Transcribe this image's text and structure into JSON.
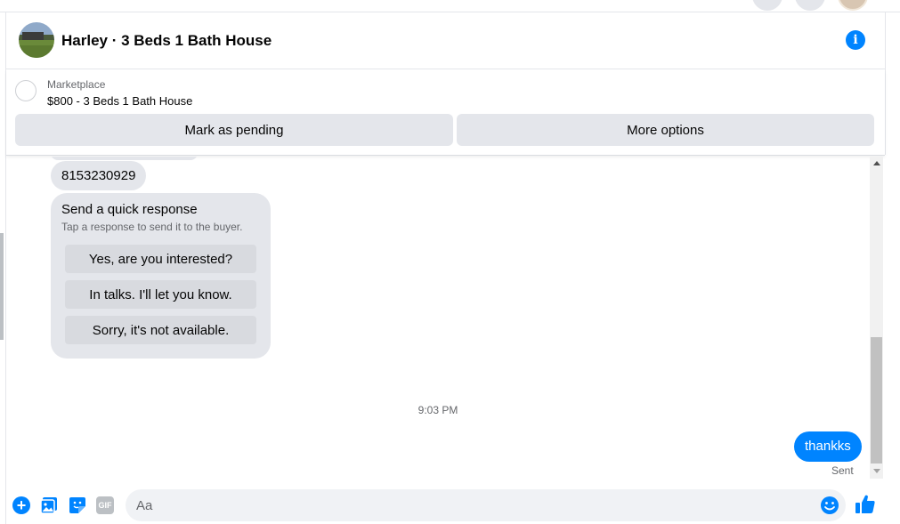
{
  "conversation": {
    "title": "Harley · 3 Beds 1 Bath House",
    "info_icon": "info-icon"
  },
  "marketplace": {
    "label": "Marketplace",
    "item": "$800 - 3 Beds 1 Bath House",
    "actions": {
      "pending": "Mark as pending",
      "more": "More options"
    }
  },
  "chat": {
    "phone_message": "8153230929",
    "quick_response": {
      "title": "Send a quick response",
      "subtitle": "Tap a response to send it to the buyer.",
      "options": [
        "Yes, are you interested?",
        "In talks. I'll let you know.",
        "Sorry, it's not available."
      ]
    },
    "timestamp": "9:03 PM",
    "sent_message": "thankks",
    "sent_status": "Sent"
  },
  "composer": {
    "placeholder": "Aa",
    "gif_label": "GIF"
  },
  "colors": {
    "accent": "#0084ff",
    "bubble_gray": "#e4e6eb",
    "input_bg": "#f0f2f5"
  }
}
